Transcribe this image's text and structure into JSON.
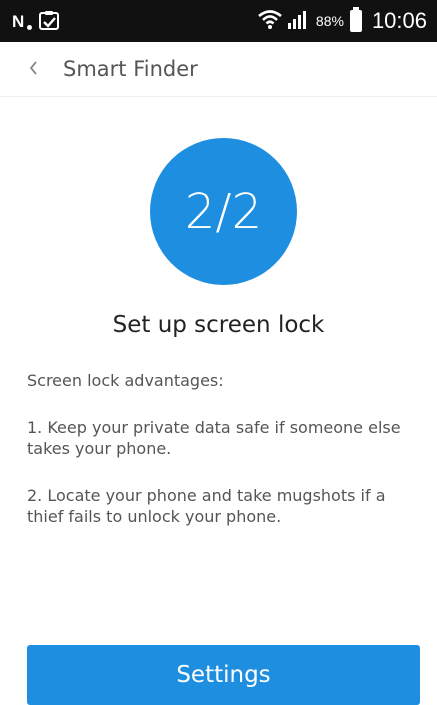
{
  "status_bar": {
    "notification_badge": "N",
    "icons": [
      "n-notification-icon",
      "clipboard-check-icon",
      "wifi-icon",
      "cell-signal-icon",
      "battery-icon"
    ],
    "battery_percent": "88%",
    "time": "10:06"
  },
  "app_bar": {
    "back_icon": "chevron-left-icon",
    "title": "Smart Finder"
  },
  "step": {
    "label": "2/2"
  },
  "heading": "Set up screen lock",
  "content": {
    "intro": "Screen lock advantages:",
    "point1": "1. Keep your private data safe if someone else takes your phone.",
    "point2": "2. Locate your phone and take mugshots if a thief fails to unlock your phone."
  },
  "buttons": {
    "settings": "Settings"
  },
  "colors": {
    "accent": "#1e8fe0",
    "status_bar": "#111111",
    "background": "#ffffff"
  }
}
